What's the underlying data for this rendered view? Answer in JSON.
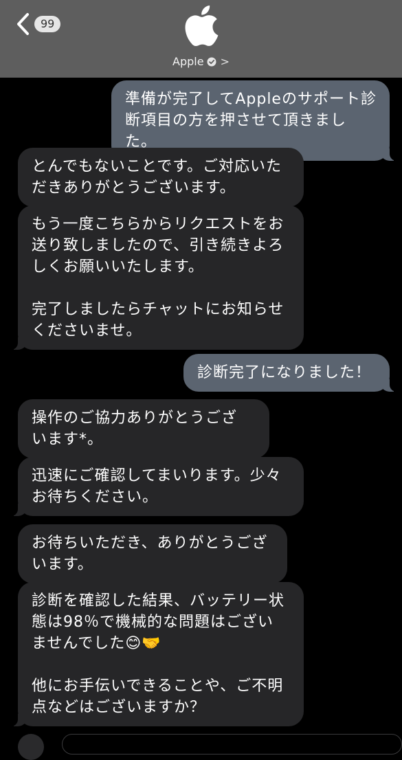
{
  "header": {
    "back_badge": "99",
    "contact_name": "Apple",
    "logo": "apple-logo",
    "verified_icon": "verified-check-icon",
    "chevron_icon": "chevron-right-icon"
  },
  "messages": [
    {
      "side": "out",
      "text": "準備が完了してAppleのサポート診\n断項目の方を押させて頂きました。"
    },
    {
      "side": "in",
      "text": "とんでもないことです。ご対応いた\nだきありがとうございます。"
    },
    {
      "side": "in",
      "text": "もう一度こちらからリクエストをお\n送り致しましたので、引き続きよろ\nしくお願いいたします。\n\n完了しましたらチャットにお知らせ\nくださいませ。"
    },
    {
      "side": "out",
      "text": "診断完了になりました！"
    },
    {
      "side": "in",
      "text": "操作のご協力ありがとうござ\nいます*。"
    },
    {
      "side": "in",
      "text": "迅速にご確認してまいります。少々\nお待ちください。"
    },
    {
      "side": "in",
      "text": "お待ちいただき、ありがとうござ\nいます。"
    },
    {
      "side": "in",
      "text": "診断を確認した結果、バッテリー状\n態は98％で機械的な問題はござい\nませんでした😊🤝\n\n他にお手伝いできることや、ご不明\n点などはございますか？"
    }
  ],
  "colors": {
    "header_bg": "#5e5e5e",
    "incoming_bubble": "#262628",
    "outgoing_bubble": "#5b6470",
    "background": "#000000"
  }
}
